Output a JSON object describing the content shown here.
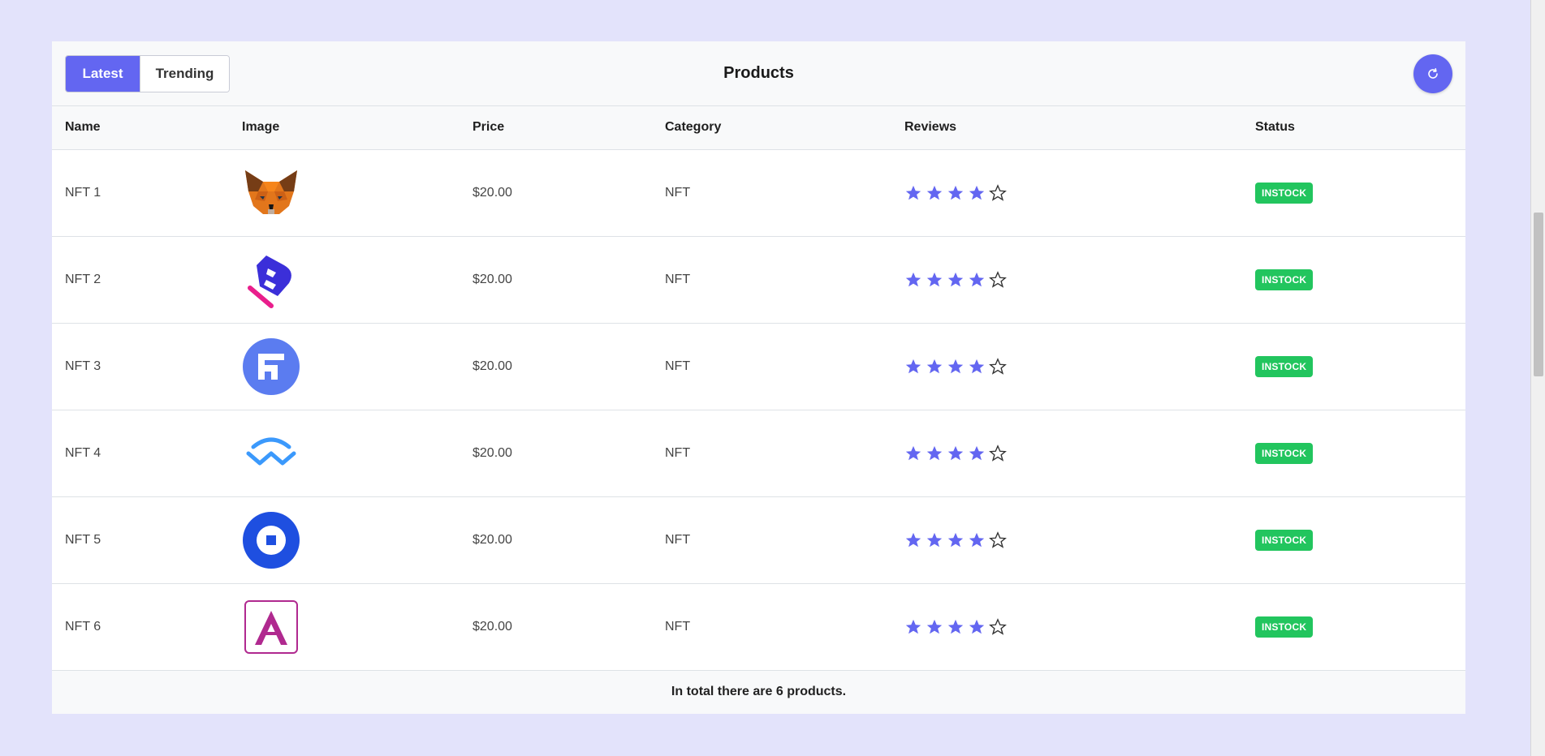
{
  "header": {
    "tabs": [
      {
        "label": "Latest",
        "active": true
      },
      {
        "label": "Trending",
        "active": false
      }
    ],
    "title": "Products",
    "refresh_icon": "refresh-icon"
  },
  "table": {
    "columns": [
      "Name",
      "Image",
      "Price",
      "Category",
      "Reviews",
      "Status"
    ],
    "rows": [
      {
        "name": "NFT 1",
        "image": "metamask-fox-logo",
        "price": "$20.00",
        "category": "NFT",
        "rating": 4,
        "rating_max": 5,
        "status": "INSTOCK"
      },
      {
        "name": "NFT 2",
        "image": "blue-b-logo",
        "price": "$20.00",
        "category": "NFT",
        "rating": 4,
        "rating_max": 5,
        "status": "INSTOCK"
      },
      {
        "name": "NFT 3",
        "image": "circle-f-logo",
        "price": "$20.00",
        "category": "NFT",
        "rating": 4,
        "rating_max": 5,
        "status": "INSTOCK"
      },
      {
        "name": "NFT 4",
        "image": "walletconnect-logo",
        "price": "$20.00",
        "category": "NFT",
        "rating": 4,
        "rating_max": 5,
        "status": "INSTOCK"
      },
      {
        "name": "NFT 5",
        "image": "blue-ring-logo",
        "price": "$20.00",
        "category": "NFT",
        "rating": 4,
        "rating_max": 5,
        "status": "INSTOCK"
      },
      {
        "name": "NFT 6",
        "image": "magenta-a-logo",
        "price": "$20.00",
        "category": "NFT",
        "rating": 4,
        "rating_max": 5,
        "status": "INSTOCK"
      }
    ]
  },
  "footer": {
    "text": "In total there are 6 products."
  },
  "colors": {
    "accent": "#6366f1",
    "status_instock": "#22c55e",
    "background": "#e3e3fb"
  }
}
